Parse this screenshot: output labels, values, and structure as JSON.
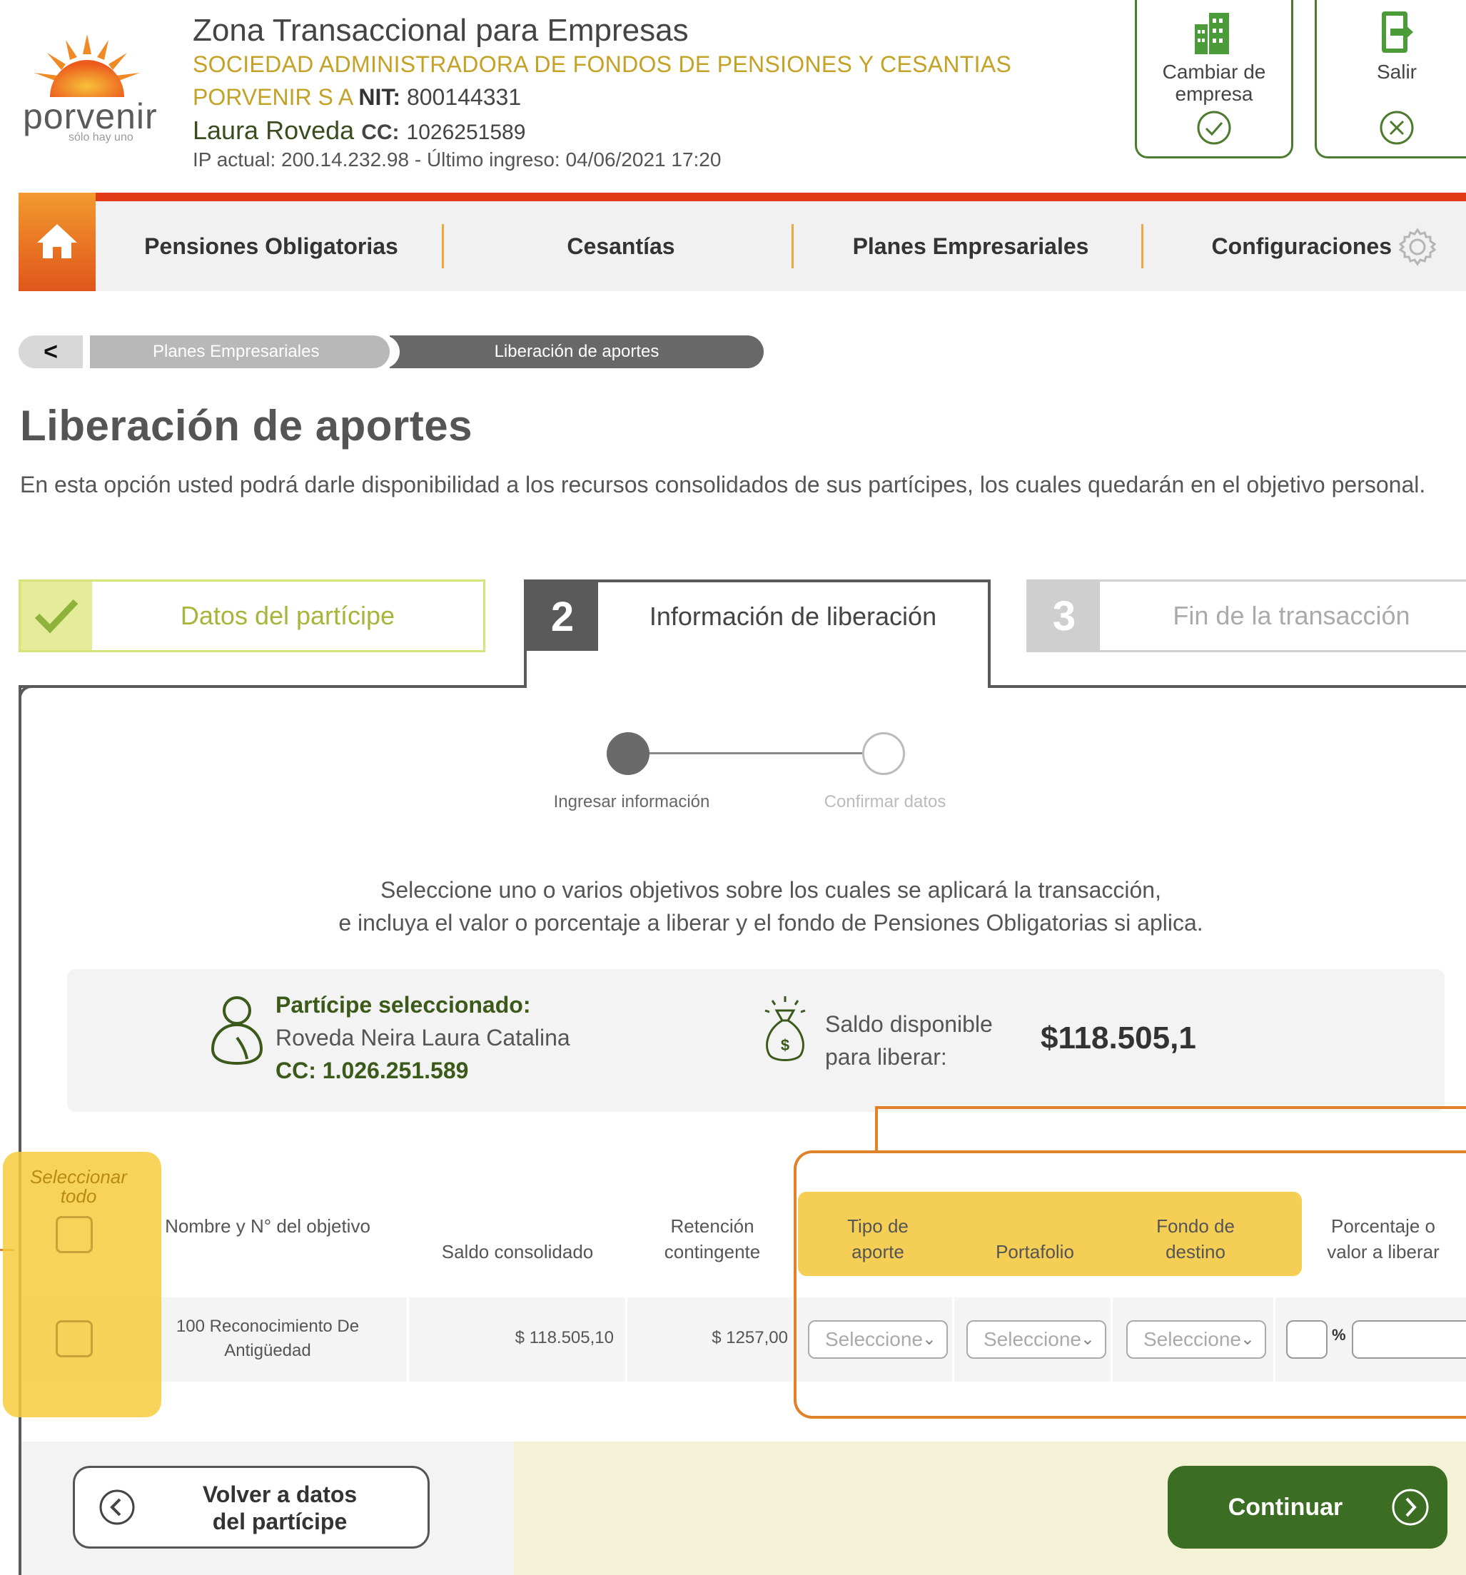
{
  "header": {
    "title": "Zona Transaccional para Empresas",
    "subtitle": "SOCIEDAD ADMINISTRADORA DE FONDOS DE PENSIONES Y CESANTIAS",
    "company": "PORVENIR S A",
    "nit_label": "NIT:",
    "nit": "800144331",
    "user": "Laura Roveda",
    "cc_label": "CC:",
    "cc": "1026251589",
    "ip_info": "IP actual: 200.14.232.98 -  Último ingreso: 04/06/2021 17:20",
    "logo_word": "porvenir",
    "logo_tagline": "sólo hay uno",
    "change_company_label": "Cambiar de empresa",
    "exit_label": "Salir"
  },
  "nav": {
    "items": [
      "Pensiones Obligatorias",
      "Cesantías",
      "Planes Empresariales",
      "Configuraciones"
    ]
  },
  "breadcrumb": {
    "back": "<",
    "items": [
      "Planes Empresariales",
      "Liberación de aportes"
    ]
  },
  "page": {
    "title": "Liberación de aportes",
    "description": "En esta opción usted podrá darle disponibilidad a los recursos consolidados de sus partícipes, los cuales quedarán en el objetivo personal."
  },
  "steps": [
    {
      "number": "",
      "label": "Datos del partícipe",
      "state": "done"
    },
    {
      "number": "2",
      "label": "Información de liberación",
      "state": "active"
    },
    {
      "number": "3",
      "label": "Fin de la transacción",
      "state": "pending"
    }
  ],
  "progress": {
    "step1": "Ingresar información",
    "step2": "Confirmar datos"
  },
  "instructions": {
    "line1": "Seleccione uno o varios objetivos sobre los cuales se aplicará la transacción,",
    "line2": "e incluya el valor o porcentaje a liberar y el fondo de Pensiones Obligatorias si aplica."
  },
  "participant": {
    "label": "Partícipe seleccionado:",
    "name": "Roveda Neira Laura Catalina",
    "cc": "CC:  1.026.251.589"
  },
  "balance": {
    "label_line1": "Saldo disponible",
    "label_line2": "para liberar:",
    "value": "$118.505,1"
  },
  "table": {
    "select_all": "Seleccionar todo",
    "headers": {
      "nombre": "Nombre y N° del objetivo",
      "saldo": "Saldo consolidado",
      "retencion": "Retención contingente",
      "tipo": "Tipo de aporte",
      "portafolio": "Portafolio",
      "fondo": "Fondo de destino",
      "porcentaje": "Porcentaje o valor a liberar"
    },
    "rows": [
      {
        "nombre_line1": "100 Reconocimiento De",
        "nombre_line2": "Antigüedad",
        "saldo": "$ 118.505,10",
        "retencion": "$ 1257,00",
        "tipo": "Seleccione",
        "portafolio": "Seleccione",
        "fondo": "Seleccione",
        "pct_sign": "%"
      }
    ]
  },
  "footer": {
    "back_line1": "Volver a datos",
    "back_line2": "del partícipe",
    "continue": "Continuar"
  },
  "colors": {
    "brand_green": "#3b6d23",
    "accent_orange": "#e0822a",
    "nav_red": "#e03a16",
    "highlight_yellow": "#f5cf55"
  }
}
